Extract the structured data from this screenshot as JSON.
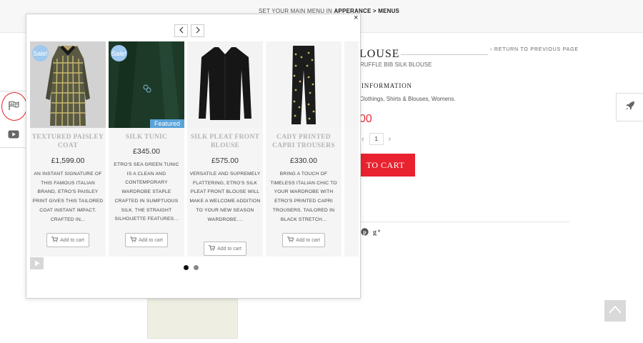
{
  "topbar": {
    "menu_note_prefix": "SET YOUR MAIN MENU IN ",
    "menu_note_link": "APPERANCE > MENUS"
  },
  "product_page": {
    "title_partial": "LOUSE",
    "return_link": "‹ RETURN TO PREVIOUS PAGE",
    "subtitle_partial": "RUFFLE BIB SILK BLOUSE",
    "info_heading_partial": "INFORMATION",
    "categories_partial": "Clothings, Shirts & Blouses, Womens.",
    "price_partial": "00",
    "quantity": "1",
    "add_to_cart_partial": "TO CART",
    "social_icons": [
      "pinterest-icon",
      "google-plus-icon"
    ]
  },
  "popup": {
    "close_label": "×",
    "products": [
      {
        "name": "TEXTURED PAISLEY COAT",
        "price": "£1,599.00",
        "badge": "Sale!",
        "featured": "",
        "description": "AN INSTANT SIGNATURE OF THIS FAMOUS ITALIAN BRAND, ETRO'S PAISLEY PRINT GIVES THIS TAILORED COAT INSTANT IMPACT. CRAFTED IN...",
        "button": "Add to cart"
      },
      {
        "name": "SILK TUNIC",
        "price": "£345.00",
        "badge": "Sale!",
        "featured": "Featured",
        "description": "ETRO'S SEA GREEN TUNIC IS A CLEAN AND CONTEMPORARY WARDROBE STAPLE CRAFTED IN SUMPTUOUS SILK. THE STRAIGHT SILHOUETTE FEATURES...",
        "button": "Add to cart"
      },
      {
        "name": "SILK PLEAT FRONT BLOUSE",
        "price": "£575.00",
        "badge": "",
        "featured": "",
        "description": "VERSATILE AND SUPREMELY FLATTERING, ETRO'S SILK PLEAT FRONT BLOUSE WILL MAKE A WELCOME ADDITION TO YOUR NEW SEASON WARDROBE....",
        "button": "Add to cart"
      },
      {
        "name": "CADY PRINTED CAPRI TROUSERS",
        "price": "£330.00",
        "badge": "",
        "featured": "",
        "description": "BRING A TOUCH OF TIMELESS ITALIAN CHIC TO YOUR WARDROBE WITH ETRO'S PRINTED CAPRI TROUSERS. TAILORED IN BLACK STRETCH...",
        "button": "Add to cart"
      }
    ],
    "pagination": {
      "pages": 2,
      "active": 1
    }
  },
  "colors": {
    "accent_red": "#e8222f",
    "sale_badge": "#9fc9ee",
    "featured_badge": "#5ba3d9"
  }
}
